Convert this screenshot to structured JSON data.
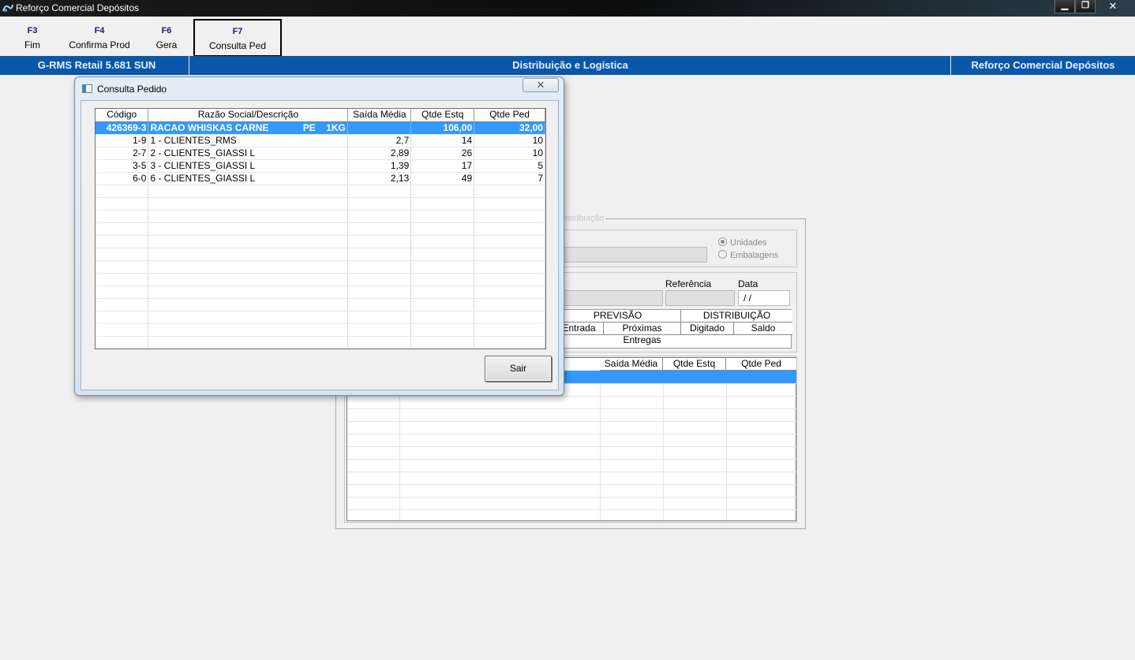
{
  "window": {
    "title": "Reforço Comercial Depósitos",
    "minimize": "▁",
    "restore": "❐",
    "close": "✕"
  },
  "toolbar": {
    "keys": [
      {
        "key": "F3",
        "label": "Fim"
      },
      {
        "key": "F4",
        "label": "Confirma Prod"
      },
      {
        "key": "F6",
        "label": "Gera"
      },
      {
        "key": "F7",
        "label": "Consulta Ped"
      }
    ]
  },
  "header_strip": {
    "left": "G-RMS Retail 5.681 SUN",
    "center": "Distribuição e Logística",
    "right": "Reforço Comercial Depósitos"
  },
  "background_form": {
    "group_legend": "Distribuição",
    "radio_unidades": "Unidades",
    "radio_embalagens": "Embalagens",
    "referencia_label": "Referência",
    "data_label": "Data",
    "data_value": " /  /",
    "previsao_header": "PREVISÃO",
    "distribuicao_header": "DISTRIBUIÇÃO",
    "col_entrada": "Entrada",
    "col_proximas": "Próximas Entregas",
    "col_digitado": "Digitado",
    "col_saldo": "Saldo",
    "lower_grid_headers": [
      "Saída Média",
      "Qtde Estq",
      "Qtde Ped"
    ]
  },
  "dialog": {
    "title": "Consulta Pedido",
    "close": "✕",
    "columns": [
      "Código",
      "Razão Social/Descrição",
      "Saída Média",
      "Qtde Estq",
      "Qtde Ped"
    ],
    "rows": [
      {
        "codigo": "426369-3",
        "descricao": "RACAO WHISKAS CARNE             PE    1KG",
        "saida": "",
        "estq": "106,00",
        "ped": "32,00",
        "selected": true
      },
      {
        "codigo": "1-9",
        "descricao": "1 - CLIENTES_RMS",
        "saida": "2,7",
        "estq": "14",
        "ped": "10"
      },
      {
        "codigo": "2-7",
        "descricao": "2 - CLIENTES_GIASSI L",
        "saida": "2,89",
        "estq": "26",
        "ped": "10"
      },
      {
        "codigo": "3-5",
        "descricao": "3 - CLIENTES_GIASSI L",
        "saida": "1,39",
        "estq": "17",
        "ped": "5"
      },
      {
        "codigo": "6-0",
        "descricao": "6 - CLIENTES_GIASSI L",
        "saida": "2,13",
        "estq": "49",
        "ped": "7"
      }
    ],
    "sair_label": "Sair"
  },
  "colors": {
    "strip": "#0a57a9",
    "selection": "#3399ff"
  }
}
